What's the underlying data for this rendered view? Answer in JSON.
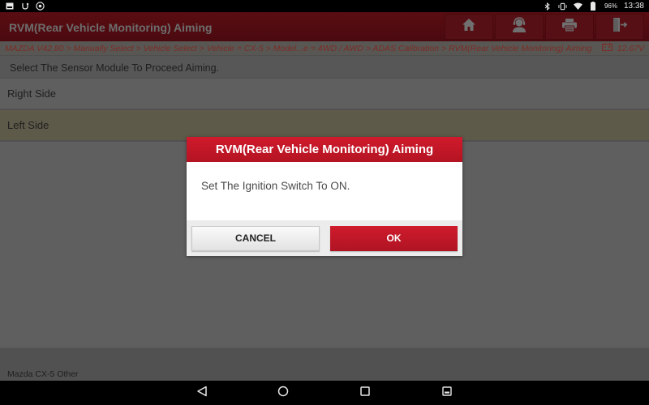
{
  "status_bar": {
    "left_icons": [
      "gallery-notification-icon",
      "usb-debug-icon",
      "launch-app-icon"
    ],
    "right_icons": [
      "bluetooth-icon",
      "vibrate-icon",
      "wifi-icon",
      "battery-icon"
    ],
    "battery_percent": "96%",
    "time": "13:38"
  },
  "header": {
    "title": "RVM(Rear Vehicle Monitoring) Aiming",
    "buttons": [
      {
        "name": "home",
        "icon": "home-icon"
      },
      {
        "name": "customer-service",
        "icon": "headset-user-icon"
      },
      {
        "name": "print",
        "icon": "printer-icon"
      },
      {
        "name": "exit",
        "icon": "exit-door-icon"
      }
    ]
  },
  "breadcrumb": {
    "path": "MAZDA V42.80 > Manually Select > Vehicle Select > Vehicle = CX-5 > Model...e = 4WD / AWD > ADAS Calibration > RVM(Rear Vehicle Monitoring) Aiming",
    "voltage": "12.67V"
  },
  "main": {
    "instruction": "Select The Sensor Module To Proceed Aiming.",
    "items": [
      {
        "label": "Right Side",
        "selected": false
      },
      {
        "label": "Left Side",
        "selected": true
      }
    ],
    "footer_text": "Mazda CX-5 Other"
  },
  "dialog": {
    "title": "RVM(Rear Vehicle Monitoring) Aiming",
    "message": "Set The Ignition Switch To ON.",
    "cancel_label": "CANCEL",
    "ok_label": "OK"
  },
  "nav_bar": {
    "buttons": [
      "back-icon",
      "home-circle-icon",
      "recents-icon",
      "screenshot-icon"
    ]
  },
  "colors": {
    "brand_red": "#c8192a",
    "header_dimmed": "#4e0b10",
    "selected_row_dimmed": "#5e5a4a",
    "breadcrumb_text": "#7c2b26"
  }
}
